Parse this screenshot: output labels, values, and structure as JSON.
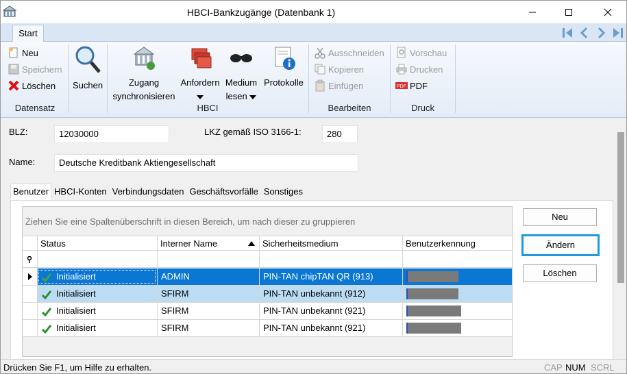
{
  "window": {
    "title": "HBCI-Bankzugänge (Datenbank 1)"
  },
  "ribbon": {
    "tab": "Start",
    "datensatz": {
      "group_label": "Datensatz",
      "neu": "Neu",
      "speichern": "Speichern",
      "loeschen": "Löschen"
    },
    "suchen": "Suchen",
    "hbci": {
      "group_label": "HBCI",
      "zugang_line1": "Zugang",
      "zugang_line2": "synchronisieren",
      "anfordern": "Anfordern",
      "medium_line1": "Medium",
      "medium_line2": "lesen",
      "protokolle": "Protokolle"
    },
    "bearbeiten": {
      "group_label": "Bearbeiten",
      "ausschneiden": "Ausschneiden",
      "kopieren": "Kopieren",
      "einfuegen": "Einfügen"
    },
    "druck": {
      "group_label": "Druck",
      "vorschau": "Vorschau",
      "drucken": "Drucken",
      "pdf": "PDF"
    }
  },
  "form": {
    "blz_label": "BLZ:",
    "blz_value": "12030000",
    "lkz_label": "LKZ gemäß ISO 3166-1:",
    "lkz_value": "280",
    "name_label": "Name:",
    "name_value": "Deutsche Kreditbank Aktiengesellschaft"
  },
  "tabs": [
    "Benutzer",
    "HBCI-Konten",
    "Verbindungsdaten",
    "Geschäftsvorfälle",
    "Sonstiges"
  ],
  "active_tab": "Benutzer",
  "grid": {
    "group_hint": "Ziehen Sie eine Spaltenüberschrift in diesen Bereich, um nach dieser zu gruppieren",
    "columns": [
      "Status",
      "Interner Name",
      "Sicherheitsmedium",
      "Benutzerkennung"
    ],
    "sort_column": "Interner Name",
    "rows": [
      {
        "status": "Initialisiert",
        "name": "ADMIN",
        "medium": "PIN-TAN chipTAN QR (913)"
      },
      {
        "status": "Initialisiert",
        "name": "SFIRM",
        "medium": "PIN-TAN unbekannt (912)"
      },
      {
        "status": "Initialisiert",
        "name": "SFIRM",
        "medium": "PIN-TAN unbekannt (921)"
      },
      {
        "status": "Initialisiert",
        "name": "SFIRM",
        "medium": "PIN-TAN unbekannt (921)"
      }
    ]
  },
  "side_buttons": {
    "neu": "Neu",
    "aendern": "Ändern",
    "loeschen": "Löschen"
  },
  "statusbar": {
    "text": "Drücken Sie F1, um Hilfe zu erhalten.",
    "cap": "CAP",
    "num": "NUM",
    "scrl": "SCRL"
  },
  "colors": {
    "selection": "#0a77d5",
    "selection_secondary": "#bcdcf4",
    "focus_border": "#1e9be0",
    "check": "#2e8b2e"
  }
}
